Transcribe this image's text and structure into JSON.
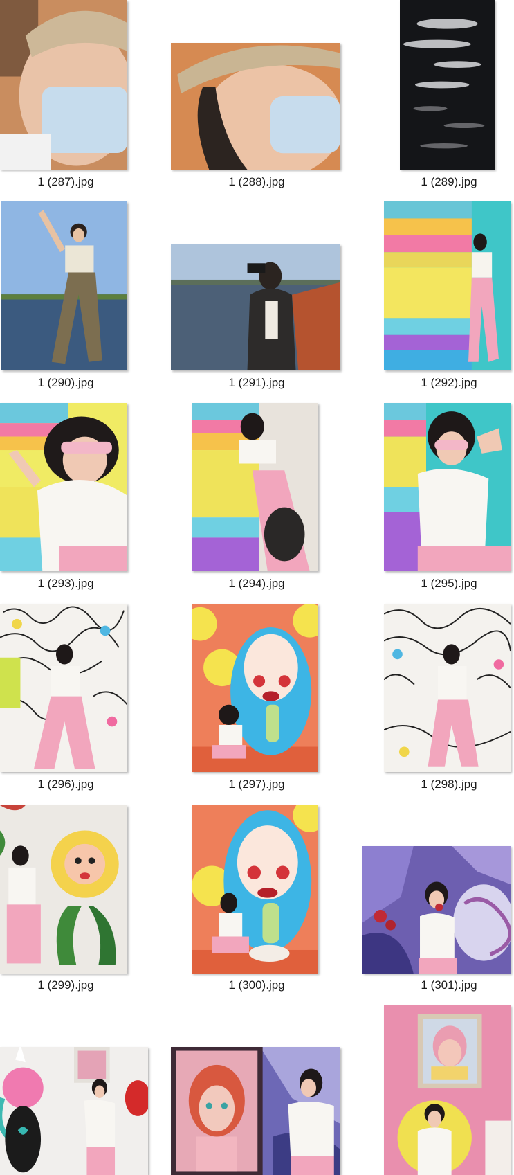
{
  "files": [
    {
      "name": "1 (287).jpg",
      "icon": "photo-thumbnail-icon"
    },
    {
      "name": "1 (288).jpg",
      "icon": "photo-thumbnail-icon"
    },
    {
      "name": "1 (289).jpg",
      "icon": "photo-thumbnail-icon"
    },
    {
      "name": "1 (290).jpg",
      "icon": "photo-thumbnail-icon"
    },
    {
      "name": "1 (291).jpg",
      "icon": "photo-thumbnail-icon"
    },
    {
      "name": "1 (292).jpg",
      "icon": "photo-thumbnail-icon"
    },
    {
      "name": "1 (293).jpg",
      "icon": "photo-thumbnail-icon"
    },
    {
      "name": "1 (294).jpg",
      "icon": "photo-thumbnail-icon"
    },
    {
      "name": "1 (295).jpg",
      "icon": "photo-thumbnail-icon"
    },
    {
      "name": "1 (296).jpg",
      "icon": "photo-thumbnail-icon"
    },
    {
      "name": "1 (297).jpg",
      "icon": "photo-thumbnail-icon"
    },
    {
      "name": "1 (298).jpg",
      "icon": "photo-thumbnail-icon"
    },
    {
      "name": "1 (299).jpg",
      "icon": "photo-thumbnail-icon"
    },
    {
      "name": "1 (300).jpg",
      "icon": "photo-thumbnail-icon"
    },
    {
      "name": "1 (301).jpg",
      "icon": "photo-thumbnail-icon"
    },
    {
      "name": "",
      "icon": "photo-thumbnail-icon"
    },
    {
      "name": "",
      "icon": "photo-thumbnail-icon"
    },
    {
      "name": "",
      "icon": "photo-thumbnail-icon"
    }
  ]
}
